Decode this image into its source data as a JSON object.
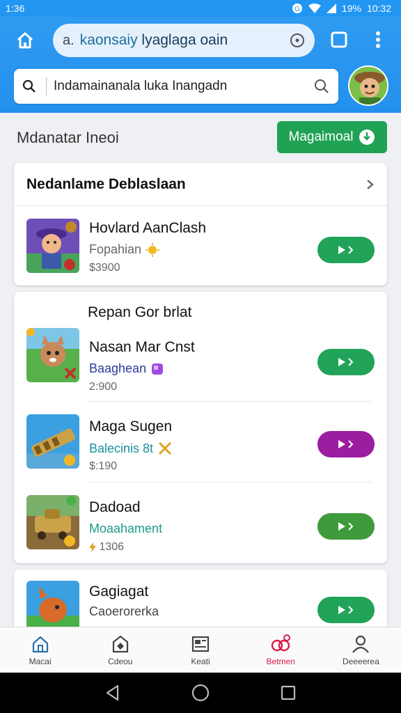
{
  "status_bar": {
    "time": "1:36",
    "battery": "19%",
    "clock": "10:32"
  },
  "browser": {
    "url_prefix": "a.",
    "url_host": "kaonsaiy",
    "url_rest": " lyaglaga oain",
    "home_icon": "home-icon",
    "info_icon": "info-circle-icon",
    "tabs_icon": "tabs-square-icon",
    "menu_icon": "overflow-menu-icon"
  },
  "search": {
    "placeholder": "Indamainanala luka Inangadn",
    "left_icon": "search-icon",
    "right_icon": "search-icon"
  },
  "header": {
    "title": "Mdanatar Ineoi",
    "button_label": "Magaimoal"
  },
  "section1": {
    "title": "Nedanlame Deblaslaan",
    "items": [
      {
        "title": "Hovlard AanClash",
        "subtitle": "Fopahian",
        "price": "$3900",
        "subtitle_color": "#666666",
        "button_color": "#22a35a"
      }
    ]
  },
  "section2": {
    "title": "Repan Gor brlat",
    "items": [
      {
        "title": "Nasan Mar Cnst",
        "subtitle": "Baaghean",
        "price": "2:900",
        "subtitle_color": "#2c3b9a",
        "button_color": "#22a35a"
      },
      {
        "title": "Maga Sugen",
        "subtitle": "Balecinis 8t",
        "price": "$:190",
        "subtitle_color": "#1a8fa0",
        "button_color": "#9c1ea0"
      },
      {
        "title": "Dadoad",
        "subtitle": "Moaahament",
        "price": "1306",
        "subtitle_color": "#1a9a8a",
        "button_color": "#3f9a3c"
      }
    ]
  },
  "section3": {
    "items": [
      {
        "title": "Gagiagat",
        "subtitle": "Caoerorerka",
        "subtitle_color": "#444444",
        "button_color": "#22a35a"
      }
    ]
  },
  "bottom_nav": [
    {
      "label": "Macai",
      "icon": "home-icon"
    },
    {
      "label": "Cdeou",
      "icon": "store-icon"
    },
    {
      "label": "Keati",
      "icon": "news-icon"
    },
    {
      "label": "Betmen",
      "icon": "games-icon",
      "active": true
    },
    {
      "label": "Deeeerea",
      "icon": "profile-icon"
    }
  ],
  "colors": {
    "app_bar": "#2196f3",
    "accent_green": "#20a255",
    "active_nav": "#d81b4a"
  }
}
